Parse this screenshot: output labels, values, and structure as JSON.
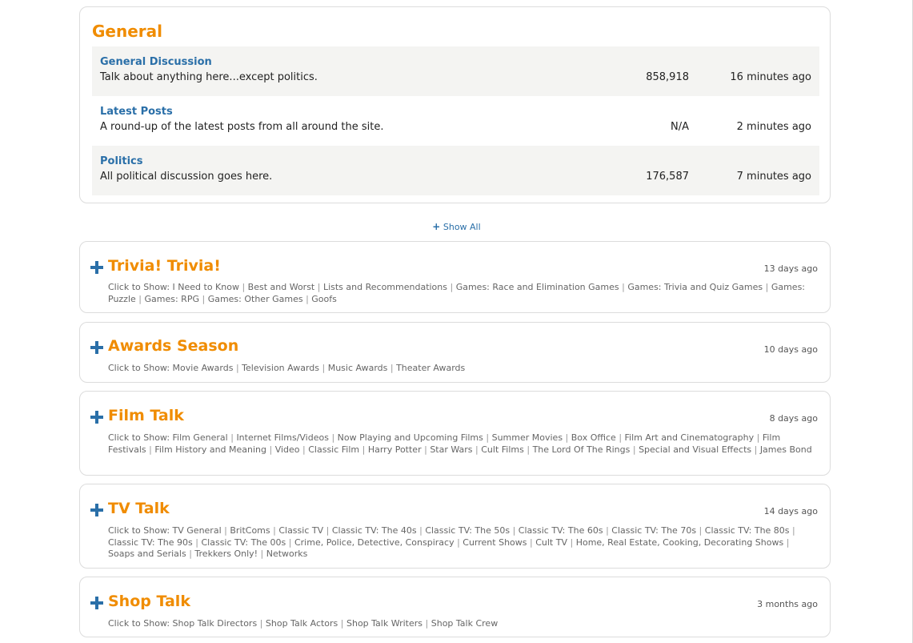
{
  "general": {
    "title": "General",
    "forums": [
      {
        "name": "General Discussion",
        "description": "Talk about anything here...except politics.",
        "posts": "858,918",
        "last_activity": "16 minutes ago"
      },
      {
        "name": "Latest Posts",
        "description": "A round-up of the latest posts from all around the site.",
        "posts": "N/A",
        "last_activity": "2 minutes ago"
      },
      {
        "name": "Politics",
        "description": "All political discussion goes here.",
        "posts": "176,587",
        "last_activity": "7 minutes ago"
      }
    ]
  },
  "show_all": {
    "icon": "plus-icon",
    "label": "Show All"
  },
  "categories": [
    {
      "title": "Trivia! Trivia!",
      "last_activity": "13 days ago",
      "prefix": "Click to Show:",
      "links": [
        "I Need to Know",
        "Best and Worst",
        "Lists and Recommendations",
        "Games: Race and Elimination Games",
        "Games: Trivia and Quiz Games",
        "Games: Puzzle",
        "Games: RPG",
        "Games: Other Games",
        "Goofs"
      ]
    },
    {
      "title": "Awards Season",
      "last_activity": "10 days ago",
      "prefix": "Click to Show:",
      "links": [
        "Movie Awards",
        "Television Awards",
        "Music Awards",
        "Theater Awards"
      ]
    },
    {
      "title": "Film Talk",
      "last_activity": "8 days ago",
      "prefix": "Click to Show:",
      "links": [
        "Film General",
        "Internet Films/Videos",
        "Now Playing and Upcoming Films",
        "Summer Movies",
        "Box Office",
        "Film Art and Cinematography",
        "Film Festivals",
        "Film History and Meaning",
        "Video",
        "Classic Film",
        "Harry Potter",
        "Star Wars",
        "Cult Films",
        "The Lord Of The Rings",
        "Special and Visual Effects",
        "James Bond"
      ]
    },
    {
      "title": "TV Talk",
      "last_activity": "14 days ago",
      "prefix": "Click to Show:",
      "links": [
        "TV General",
        "BritComs",
        "Classic TV",
        "Classic TV: The 40s",
        "Classic TV: The 50s",
        "Classic TV: The 60s",
        "Classic TV: The 70s",
        "Classic TV: The 80s",
        "Classic TV: The 90s",
        "Classic TV: The 00s",
        "Crime, Police, Detective, Conspiracy",
        "Current Shows",
        "Cult TV",
        "Home, Real Estate, Cooking, Decorating Shows",
        "Soaps and Serials",
        "Trekkers Only!",
        "Networks"
      ]
    },
    {
      "title": "Shop Talk",
      "last_activity": "3 months ago",
      "prefix": "Click to Show:",
      "links": [
        "Shop Talk Directors",
        "Shop Talk Actors",
        "Shop Talk Writers",
        "Shop Talk Crew"
      ]
    }
  ]
}
